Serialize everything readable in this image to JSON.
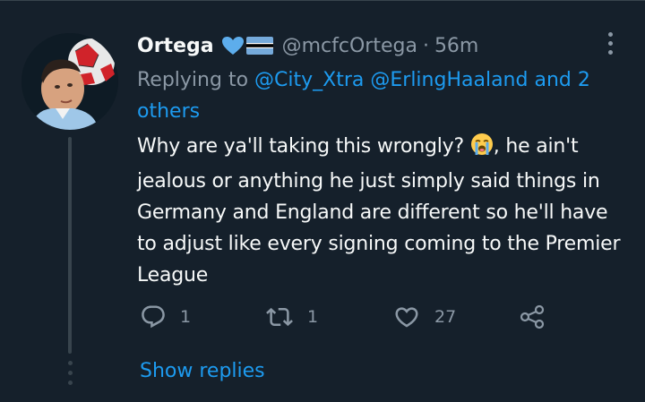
{
  "tweet": {
    "author": {
      "display_name": "Ortega",
      "handle": "@mcfcOrtega",
      "separator": "·",
      "time": "56m",
      "name_emoji": [
        "blue-heart",
        "botswana-flag"
      ]
    },
    "replying_prefix": "Replying to",
    "replying_mentions": [
      "@City_Xtra",
      "@ErlingHaaland"
    ],
    "replying_suffix": "and 2 others",
    "text_before_emoji": "Why are ya'll taking this wrongly?",
    "text_after_emoji": ", he ain't jealous or anything he just simply said things in Germany and England are different so he'll have to adjust like every signing coming to the Premier League",
    "text_emoji": "loudly-crying-face",
    "actions": {
      "reply_count": "1",
      "retweet_count": "1",
      "like_count": "27"
    }
  },
  "thread": {
    "show_replies_label": "Show replies"
  },
  "colors": {
    "background": "#15202b",
    "text": "#f7f9f9",
    "muted": "#8b98a5",
    "link": "#1d9bf0",
    "divider": "#38444d"
  }
}
